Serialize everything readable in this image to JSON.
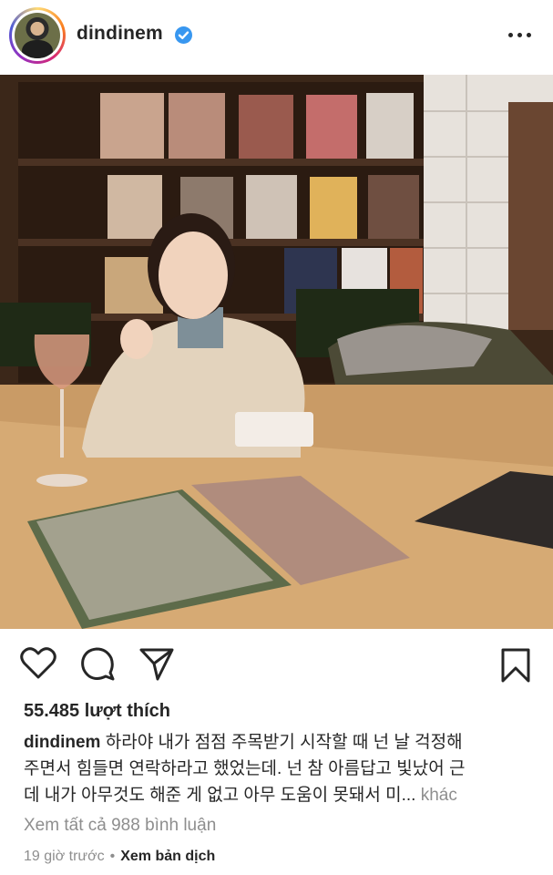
{
  "header": {
    "username": "dindinem",
    "verified": true,
    "more_glyph": "more-options-icon"
  },
  "post": {
    "image_icon": "photo",
    "tag_icon": "user-tag-icon"
  },
  "actions": {
    "like_icon": "heart-icon",
    "comment_icon": "comment-icon",
    "share_icon": "paper-plane-icon",
    "save_icon": "bookmark-icon"
  },
  "likes": {
    "text": "55.485 lượt thích"
  },
  "caption": {
    "username": "dindinem",
    "line1": "하라야 내가 점점 주목받기 시작할 때 넌 날 걱정해",
    "line2": "주면서 힘들면 연락하라고 했었는데. 넌 참 아름답고 빛났어 근",
    "line3": "데 내가 아무것도 해준 게 없고 아무 도움이 못돼서 미...",
    "more_label": "khác"
  },
  "comments": {
    "view_all": "Xem tất cả 988 bình luận"
  },
  "footer": {
    "timestamp": "19 giờ trước",
    "separator": "•",
    "translate_label": "Xem bản dịch"
  },
  "colors": {
    "text": "#262626",
    "muted": "#8e8e8e",
    "verified_blue": "#3897f0"
  }
}
